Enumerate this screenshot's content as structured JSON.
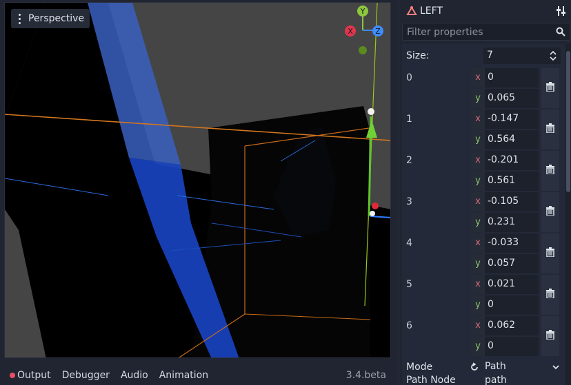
{
  "viewport": {
    "perspective_label": "Perspective",
    "gizmo": {
      "x": "X",
      "y": "Y",
      "z": "Z"
    }
  },
  "bottom_bar": {
    "tabs": [
      "Output",
      "Debugger",
      "Audio",
      "Animation"
    ],
    "version": "3.4.beta"
  },
  "inspector": {
    "node_name": "LEFT",
    "filter_placeholder": "Filter properties",
    "size_label": "Size:",
    "size_value": "7",
    "elements": [
      {
        "index": "0",
        "x": "0",
        "y": "0.065"
      },
      {
        "index": "1",
        "x": "-0.147",
        "y": "0.564"
      },
      {
        "index": "2",
        "x": "-0.201",
        "y": "0.561"
      },
      {
        "index": "3",
        "x": "-0.105",
        "y": "0.231"
      },
      {
        "index": "4",
        "x": "-0.033",
        "y": "0.057"
      },
      {
        "index": "5",
        "x": "0.021",
        "y": "0"
      },
      {
        "index": "6",
        "x": "0.062",
        "y": "0"
      }
    ],
    "axis_x": "x",
    "axis_y": "y",
    "mode_label": "Mode",
    "mode_value": "Path",
    "path_node_label": "Path Node",
    "path_node_value": "path"
  },
  "colors": {
    "background": "#202531",
    "panel": "#232938",
    "axis_x": "#d6697c",
    "axis_y": "#8ec16b",
    "accent_blue": "#2f66e0"
  }
}
